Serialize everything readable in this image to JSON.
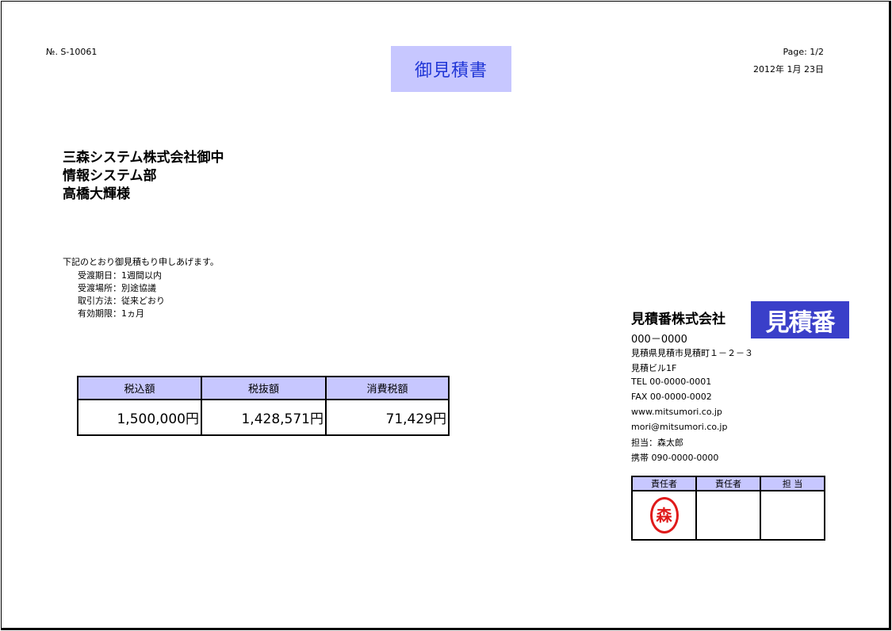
{
  "header": {
    "doc_number": "№. S-10061",
    "title": "御見積書",
    "page": "Page: 1/2",
    "date": "2012年 1月 23日"
  },
  "recipient": {
    "company": "三森システム株式会社御中",
    "department": "情報システム部",
    "person": "高橋大輝様"
  },
  "intro": "下記のとおり御見積もり申しあげます。",
  "terms": [
    "受渡期日：1週間以内",
    "受渡場所：別途協議",
    "取引方法：従来どおり",
    "有効期限：1ヵ月"
  ],
  "amounts": {
    "headers": [
      "税込額",
      "税抜額",
      "消費税額"
    ],
    "values": [
      "1,500,000円",
      "1,428,571円",
      "71,429円"
    ]
  },
  "issuer": {
    "company": "見積番株式会社",
    "logo_text": "見積番",
    "postal": "000－0000",
    "address1": "見積県見積市見積町１－２－３",
    "address2": "見積ビル1F",
    "tel": "TEL 00-0000-0001",
    "fax": "FAX 00-0000-0002",
    "web": "www.mitsumori.co.jp",
    "email": "mori@mitsumori.co.jp",
    "staff": "担当：森太郎",
    "mobile": "携帯 090-0000-0000"
  },
  "approval": {
    "headers": [
      "責任者",
      "責任者",
      "担 当"
    ],
    "seal_text": "森"
  },
  "colors": {
    "header_fill": "#c7c7ff",
    "title_text": "#1f35d6",
    "logo_fill": "#3a3fc9",
    "seal": "#e01a1a"
  }
}
